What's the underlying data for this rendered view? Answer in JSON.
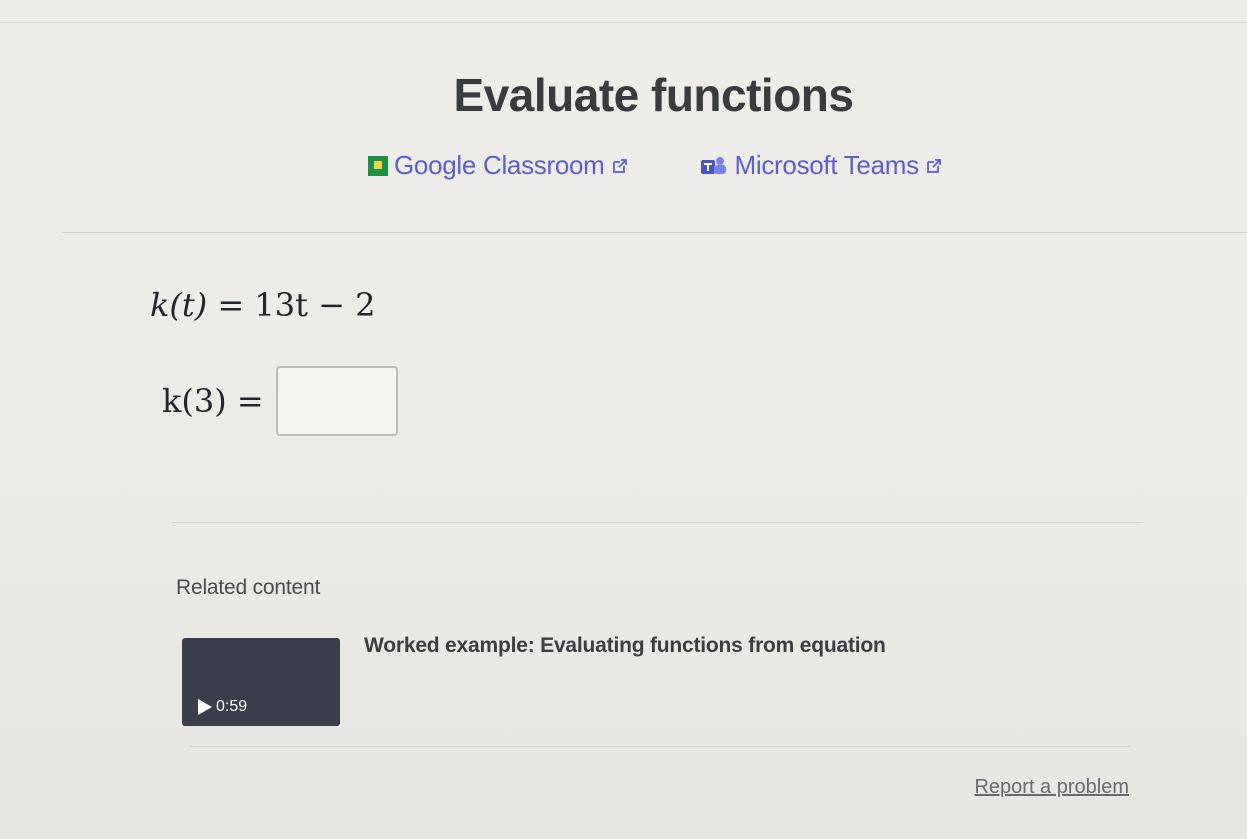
{
  "page": {
    "title": "Evaluate functions"
  },
  "share": {
    "google_classroom": "Google Classroom",
    "microsoft_teams": "Microsoft Teams"
  },
  "problem": {
    "function_lhs": "k(t)",
    "function_rhs": "13t − 2",
    "question_lhs": "k(3)",
    "answer_value": ""
  },
  "related": {
    "heading": "Related content",
    "video": {
      "title": "Worked example: Evaluating functions from equation",
      "duration": "0:59"
    }
  },
  "footer": {
    "report_label": "Report a problem"
  },
  "colors": {
    "link": "#5b5fc7",
    "background": "#ecebe7",
    "thumbnail": "#3b3e4a"
  }
}
